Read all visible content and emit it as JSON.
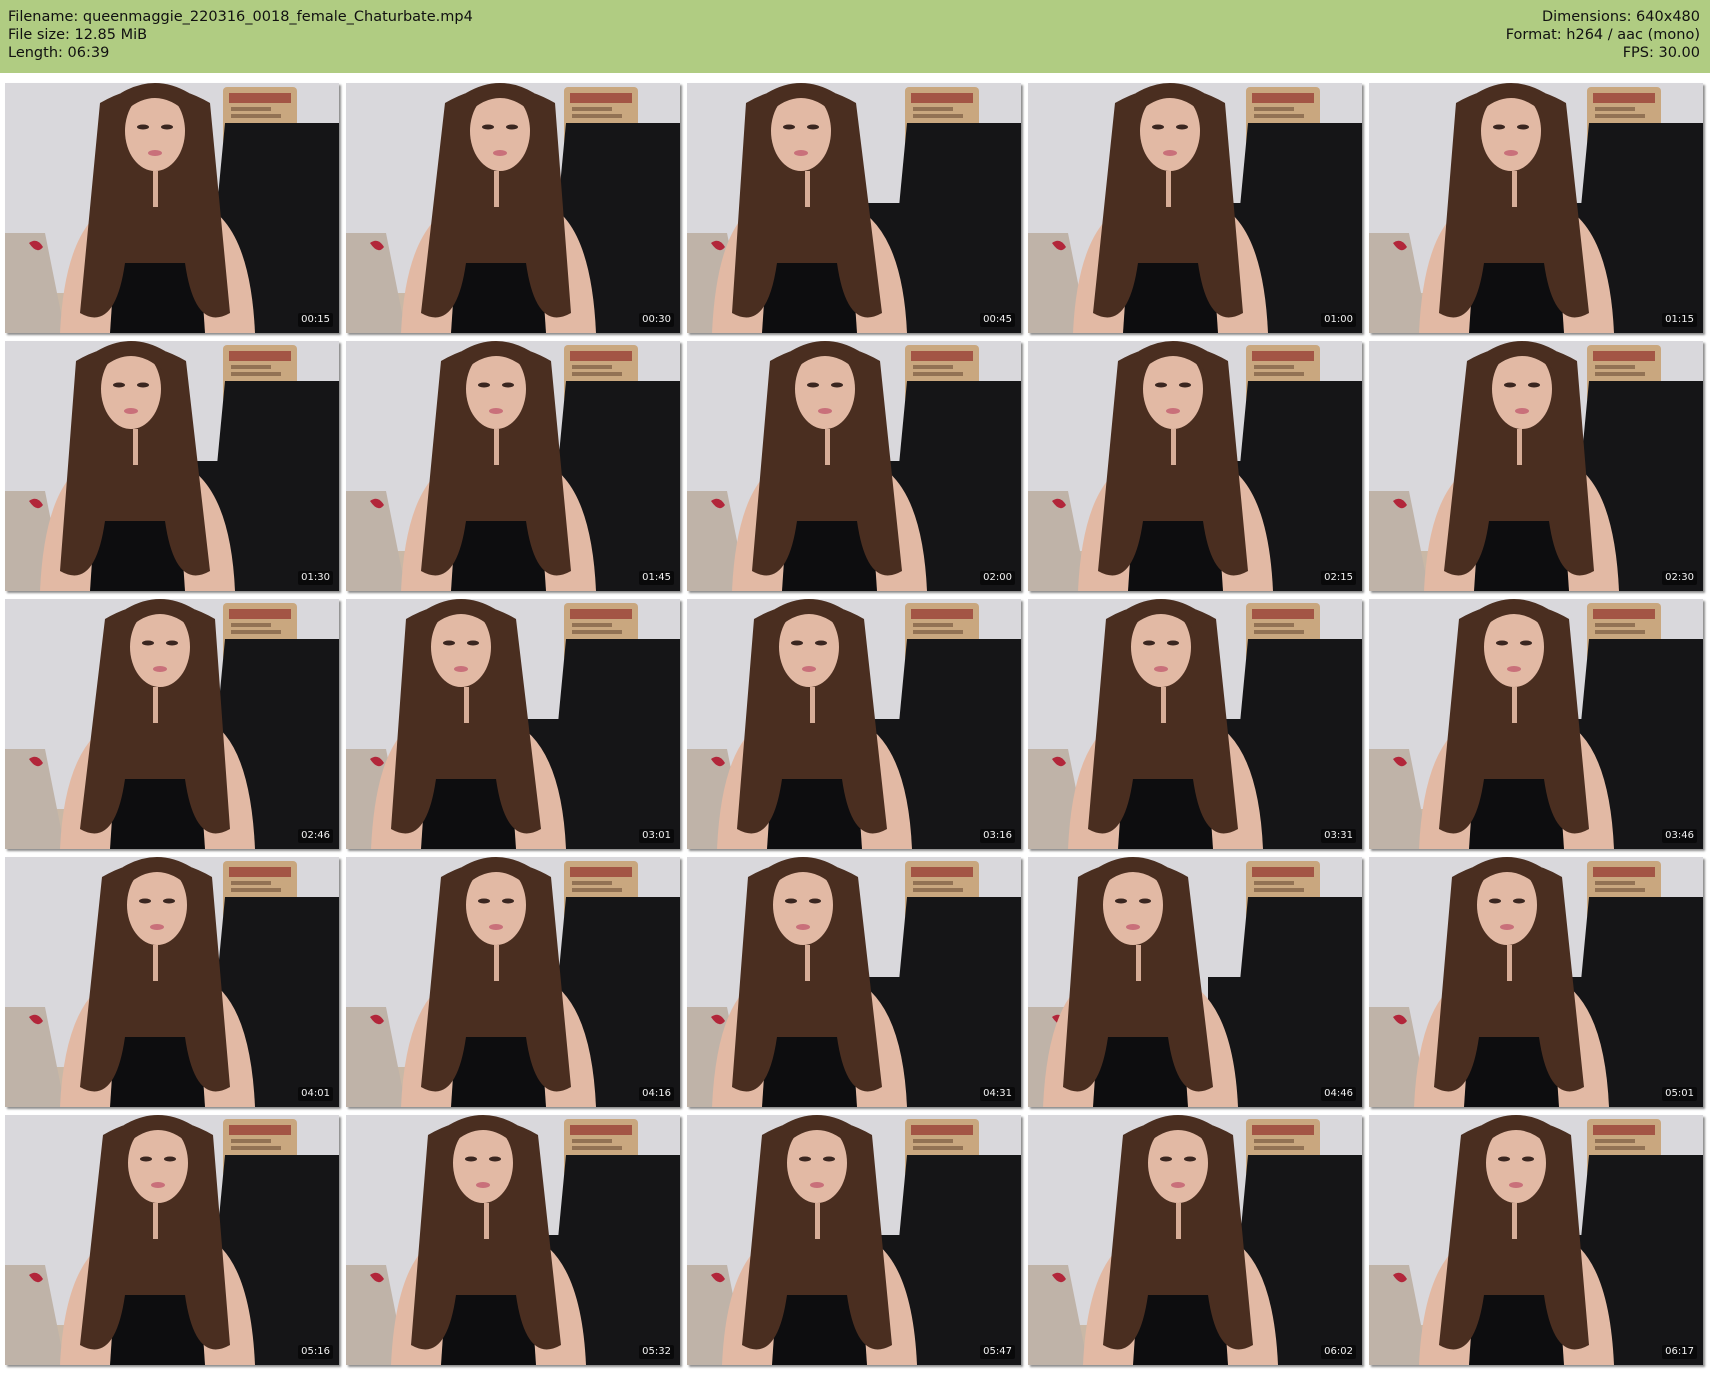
{
  "file_info": {
    "filename_line": "Filename: queenmaggie_220316_0018_female_Chaturbate.mp4",
    "filesize_line": "File size: 12.85 MiB",
    "length_line": "Length: 06:39",
    "dimensions_line": "Dimensions: 640x480",
    "format_line": "Format: h264 / aac (mono)",
    "fps_line": "FPS: 30.00"
  },
  "colors": {
    "header_bg": "#b0cc82",
    "wall": "#d9d8dc",
    "chair": "#151517",
    "hair": "#4a2e20",
    "skin": "#e2b9a4",
    "top": "#0d0d0f",
    "sign": "#c9a77f"
  },
  "thumbnails": [
    {
      "time": "00:15"
    },
    {
      "time": "00:30"
    },
    {
      "time": "00:45"
    },
    {
      "time": "01:00"
    },
    {
      "time": "01:15"
    },
    {
      "time": "01:30"
    },
    {
      "time": "01:45"
    },
    {
      "time": "02:00"
    },
    {
      "time": "02:15"
    },
    {
      "time": "02:30"
    },
    {
      "time": "02:46"
    },
    {
      "time": "03:01"
    },
    {
      "time": "03:16"
    },
    {
      "time": "03:31"
    },
    {
      "time": "03:46"
    },
    {
      "time": "04:01"
    },
    {
      "time": "04:16"
    },
    {
      "time": "04:31"
    },
    {
      "time": "04:46"
    },
    {
      "time": "05:01"
    },
    {
      "time": "05:16"
    },
    {
      "time": "05:32"
    },
    {
      "time": "05:47"
    },
    {
      "time": "06:02"
    },
    {
      "time": "06:17"
    }
  ]
}
